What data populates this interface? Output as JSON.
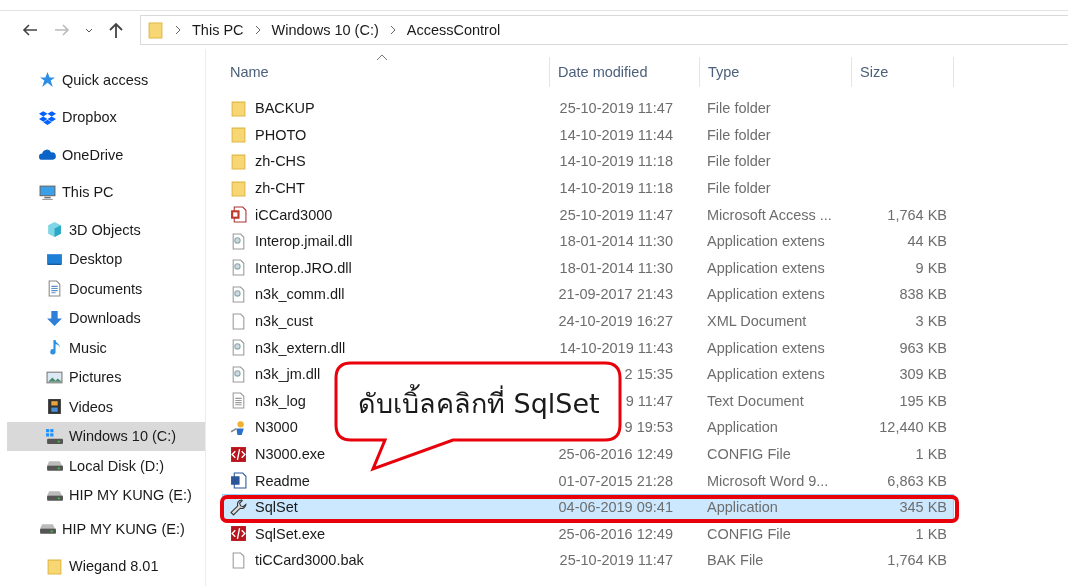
{
  "address_bar": {
    "path": [
      "This PC",
      "Windows 10 (C:)",
      "AccessControl"
    ]
  },
  "sidebar": [
    {
      "label": "Quick access",
      "kind": "star",
      "selected": false
    },
    {
      "label": "Dropbox",
      "kind": "dropbox",
      "selected": false
    },
    {
      "label": "OneDrive",
      "kind": "cloud",
      "selected": false
    },
    {
      "label": "This PC",
      "kind": "pc",
      "selected": false,
      "children": [
        {
          "label": "3D Objects",
          "kind": "cube",
          "selected": false
        },
        {
          "label": "Desktop",
          "kind": "desktop",
          "selected": false
        },
        {
          "label": "Documents",
          "kind": "document",
          "selected": false
        },
        {
          "label": "Downloads",
          "kind": "download",
          "selected": false
        },
        {
          "label": "Music",
          "kind": "music",
          "selected": false
        },
        {
          "label": "Pictures",
          "kind": "picture",
          "selected": false
        },
        {
          "label": "Videos",
          "kind": "video",
          "selected": false
        },
        {
          "label": "Windows 10 (C:)",
          "kind": "drive-windows",
          "selected": true
        },
        {
          "label": "Local Disk (D:)",
          "kind": "drive",
          "selected": false
        },
        {
          "label": "HIP MY KUNG (E:)",
          "kind": "drive",
          "selected": false
        }
      ]
    },
    {
      "label": "HIP MY KUNG (E:)",
      "kind": "drive",
      "selected": false,
      "children": [
        {
          "label": "Wiegand 8.01",
          "kind": "folder",
          "selected": false
        }
      ]
    }
  ],
  "table": {
    "columns": [
      "Name",
      "Date modified",
      "Type",
      "Size"
    ],
    "rows": [
      {
        "name": "BACKUP",
        "date": "25-10-2019 11:47",
        "type": "File folder",
        "size": "",
        "kind": "folder",
        "selected": false,
        "marked": false
      },
      {
        "name": "PHOTO",
        "date": "14-10-2019 11:44",
        "type": "File folder",
        "size": "",
        "kind": "folder",
        "selected": false,
        "marked": false
      },
      {
        "name": "zh-CHS",
        "date": "14-10-2019 11:18",
        "type": "File folder",
        "size": "",
        "kind": "folder",
        "selected": false,
        "marked": false
      },
      {
        "name": "zh-CHT",
        "date": "14-10-2019 11:18",
        "type": "File folder",
        "size": "",
        "kind": "folder",
        "selected": false,
        "marked": false
      },
      {
        "name": "iCCard3000",
        "date": "25-10-2019 11:47",
        "type": "Microsoft Access ...",
        "size": "1,764 KB",
        "kind": "access",
        "selected": false,
        "marked": false
      },
      {
        "name": "Interop.jmail.dll",
        "date": "18-01-2014 11:30",
        "type": "Application extens",
        "size": "44 KB",
        "kind": "dll",
        "selected": false,
        "marked": false
      },
      {
        "name": "Interop.JRO.dll",
        "date": "18-01-2014 11:30",
        "type": "Application extens",
        "size": "9 KB",
        "kind": "dll",
        "selected": false,
        "marked": false
      },
      {
        "name": "n3k_comm.dll",
        "date": "21-09-2017 21:43",
        "type": "Application extens",
        "size": "838 KB",
        "kind": "dll",
        "selected": false,
        "marked": false
      },
      {
        "name": "n3k_cust",
        "date": "24-10-2019 16:27",
        "type": "XML Document",
        "size": "3 KB",
        "kind": "blank",
        "selected": false,
        "marked": false
      },
      {
        "name": "n3k_extern.dll",
        "date": "14-10-2019 11:43",
        "type": "Application extens",
        "size": "963 KB",
        "kind": "dll",
        "selected": false,
        "marked": false
      },
      {
        "name": "n3k_jm.dll",
        "date": "2 15:35",
        "type": "Application extens",
        "size": "309 KB",
        "kind": "dll",
        "selected": false,
        "marked": false
      },
      {
        "name": "n3k_log",
        "date": "9 11:47",
        "type": "Text Document",
        "size": "195 KB",
        "kind": "text",
        "selected": false,
        "marked": false
      },
      {
        "name": "N3000",
        "date": "9 19:53",
        "type": "Application",
        "size": "12,440 KB",
        "kind": "app",
        "selected": false,
        "marked": false
      },
      {
        "name": "N3000.exe",
        "date": "25-06-2016 12:49",
        "type": "CONFIG File",
        "size": "1 KB",
        "kind": "config",
        "selected": false,
        "marked": false
      },
      {
        "name": "Readme",
        "date": "01-07-2015 21:28",
        "type": "Microsoft Word 9...",
        "size": "6,863 KB",
        "kind": "word",
        "selected": false,
        "marked": false
      },
      {
        "name": "SqlSet",
        "date": "04-06-2019 09:41",
        "type": "Application",
        "size": "345 KB",
        "kind": "tool",
        "selected": true,
        "marked": true
      },
      {
        "name": "SqlSet.exe",
        "date": "25-06-2016 12:49",
        "type": "CONFIG File",
        "size": "1 KB",
        "kind": "config",
        "selected": false,
        "marked": false
      },
      {
        "name": "tiCCard3000.bak",
        "date": "25-10-2019 11:47",
        "type": "BAK File",
        "size": "1,764 KB",
        "kind": "blank",
        "selected": false,
        "marked": false
      }
    ]
  },
  "callout": {
    "text": "ดับเบิ้ลคลิกที่ SqlSet"
  }
}
